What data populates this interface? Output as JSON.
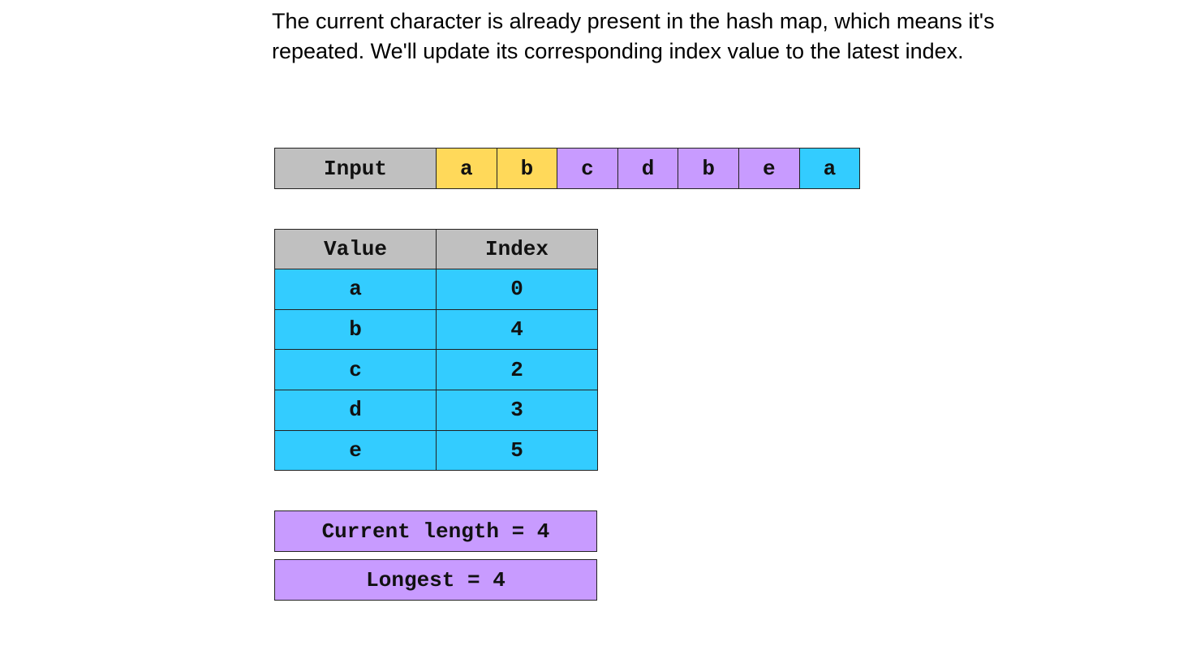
{
  "description": "The current character is already present in the hash map, which means it's repeated. We'll update its corresponding index value to the latest index.",
  "input": {
    "label": "Input",
    "chars": [
      {
        "char": "a",
        "color": "#ffd95a"
      },
      {
        "char": "b",
        "color": "#ffd95a"
      },
      {
        "char": "c",
        "color": "#c89bff"
      },
      {
        "char": "d",
        "color": "#c89bff"
      },
      {
        "char": "b",
        "color": "#c89bff"
      },
      {
        "char": "e",
        "color": "#c89bff"
      },
      {
        "char": "a",
        "color": "#33ccff"
      }
    ]
  },
  "hash_map": {
    "headers": [
      "Value",
      "Index"
    ],
    "rows": [
      [
        "a",
        "0"
      ],
      [
        "b",
        "4"
      ],
      [
        "c",
        "2"
      ],
      [
        "d",
        "3"
      ],
      [
        "e",
        "5"
      ]
    ]
  },
  "current_length": "Current length = 4",
  "longest": "Longest = 4",
  "colors": {
    "header": "#c0c0c0",
    "row": "#33ccff",
    "stat": "#c89bff"
  }
}
